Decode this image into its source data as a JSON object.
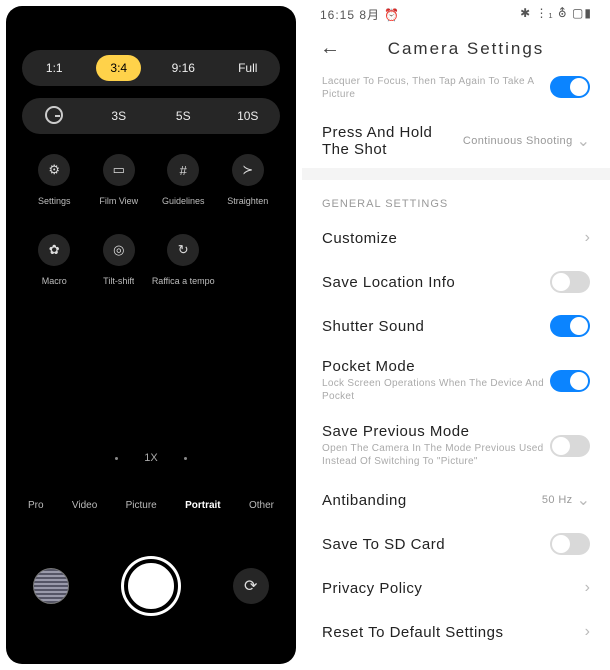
{
  "camera": {
    "ratios": {
      "r1": "1:1",
      "r2": "3:4",
      "r3": "9:16",
      "r4": "Full"
    },
    "timers": {
      "t1": "3S",
      "t2": "5S",
      "t3": "10S"
    },
    "tools": {
      "settings": "Settings",
      "filmview": "Film View",
      "guidelines": "Guidelines",
      "straighten": "Straighten",
      "macro": "Macro",
      "tiltshift": "Tilt-shift",
      "raffica": "Raffica a tempo"
    },
    "zoom": "1X",
    "modes": {
      "pro": "Pro",
      "video": "Video",
      "picture": "Picture",
      "portrait": "Portrait",
      "other": "Other"
    }
  },
  "status": {
    "time": "16:15",
    "date": "8月",
    "alarm": "⏰",
    "icons": "✱ ⋮₁ ⛢ ▢▮"
  },
  "settings": {
    "title": "Camera Settings",
    "focus_sub": "Lacquer To Focus, Then Tap Again To Take A Picture",
    "press_hold": "Press And Hold The Shot",
    "press_hold_val": "Continuous Shooting",
    "section_general": "GENERAL SETTINGS",
    "customize": "Customize",
    "savelocation": "Save Location Info",
    "shuttersound": "Shutter Sound",
    "pocketmode": "Pocket Mode",
    "pocketmode_sub": "Lock Screen Operations When The Device And Pocket",
    "saveprev": "Save Previous Mode",
    "saveprev_sub": "Open The Camera In The Mode Previous Used Instead Of Switching To \"Picture\"",
    "antibanding": "Antibanding",
    "antibanding_val": "50 Hz",
    "savesd": "Save To SD Card",
    "privacy": "Privacy Policy",
    "reset": "Reset To Default Settings"
  }
}
